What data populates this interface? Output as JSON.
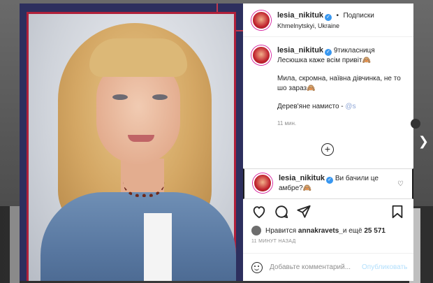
{
  "post": {
    "username": "lesia_nikituk",
    "follow_separator": "•",
    "follow_label": "Подписки",
    "location": "Khmelnytskyi, Ukraine"
  },
  "caption": {
    "username": "lesia_nikituk",
    "line1": "9тикласниця Лесюшка каже всім привіт🙈",
    "line2": "Мила, скромна, наївна дівчинка, не то шо зараз🙈",
    "line3_prefix": "Дерев'яне намисто - ",
    "mention": "@s                 ",
    "time": "11 мин."
  },
  "reply": {
    "username": "lesia_nikituk",
    "text": "Ви бачили це амбре?🙈"
  },
  "likes": {
    "prefix": "Нравится ",
    "user": "annakravets_",
    "middle": " и ещё ",
    "count": "25 571"
  },
  "timestamp": "11 МИНУТ НАЗАД",
  "add_comment": {
    "placeholder": "Добавьте комментарий...",
    "publish_label": "Опубликовать"
  },
  "icons": {
    "verified": "verified-badge-icon",
    "heart": "heart-icon",
    "comment": "comment-icon",
    "share": "paper-plane-icon",
    "save": "bookmark-icon",
    "plus": "plus-circle-icon",
    "emoji": "emoji-icon",
    "next": "chevron-right-icon"
  },
  "colors": {
    "verified": "#3897f0",
    "publish_disabled": "#b2dffc",
    "text": "#262626",
    "muted": "#8e8e8e"
  }
}
